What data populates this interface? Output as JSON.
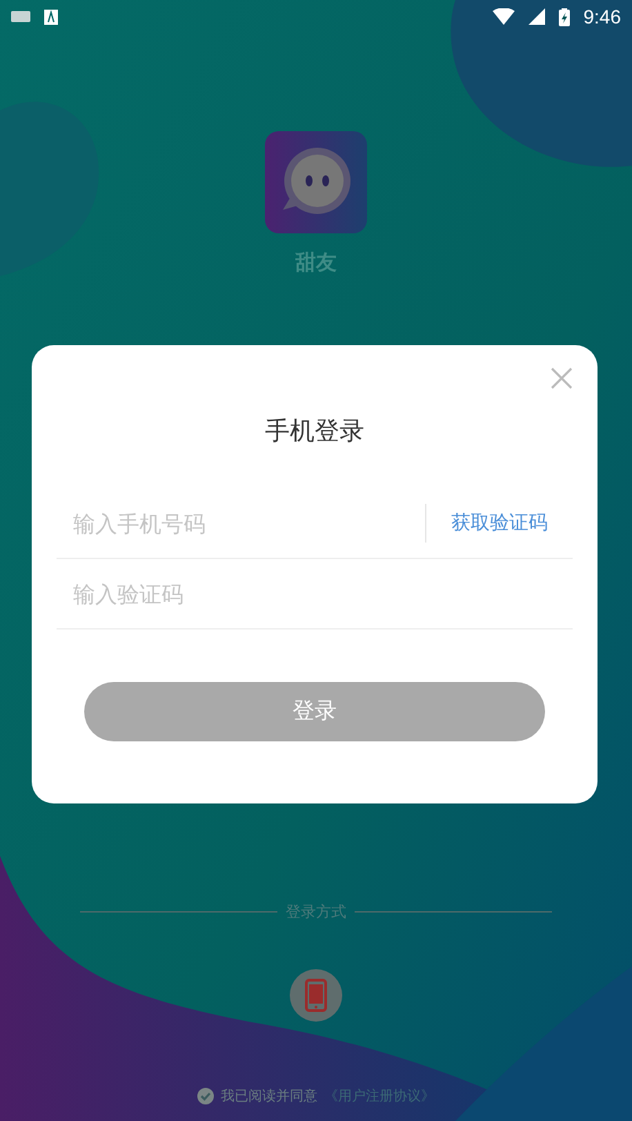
{
  "status_bar": {
    "time": "9:46"
  },
  "app": {
    "name": "甜友"
  },
  "dialog": {
    "title": "手机登录",
    "phone_placeholder": "输入手机号码",
    "get_code": "获取验证码",
    "code_placeholder": "输入验证码",
    "login_button": "登录",
    "login_enabled": false
  },
  "login_methods": {
    "label": "登录方式"
  },
  "agreement": {
    "checked": true,
    "text": "我已阅读并同意",
    "link": "《用户注册协议》"
  }
}
